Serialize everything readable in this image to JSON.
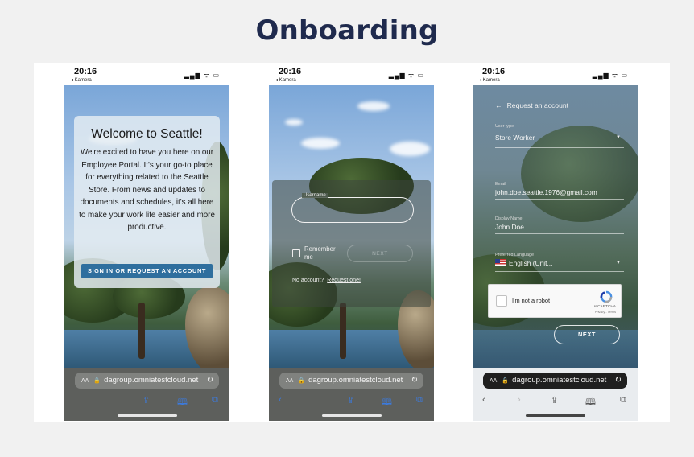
{
  "slide": {
    "title": "Onboarding"
  },
  "phones": [
    {
      "status": {
        "time": "20:16",
        "back_label": "◂ Kamera",
        "icons": "▂▄▆ ᯤ ▭"
      },
      "url": {
        "aa": "AA",
        "text": "dagroup.omniatestcloud.net"
      },
      "welcome": {
        "title": "Welcome to Seattle!",
        "body": "We're excited to have you here on our Employee Portal. It's your go-to place for everything related to the Seattle Store. From news and updates to documents and schedules, it's all here to make your work life easier and more productive.",
        "button": "SIGN IN OR REQUEST AN ACCOUNT"
      }
    },
    {
      "status": {
        "time": "20:16",
        "back_label": "◂ Kamera",
        "icons": "▂▄▆ ᯤ ▭"
      },
      "url": {
        "aa": "AA",
        "text": "dagroup.omniatestcloud.net"
      },
      "login": {
        "username_label": "Username",
        "remember_label": "Remember me",
        "next_label": "NEXT",
        "no_account": "No account?",
        "request_link": "Request one!"
      }
    },
    {
      "status": {
        "time": "20:16",
        "back_label": "◂ Kamera",
        "icons": "▂▄▆ ᯤ ▭"
      },
      "url": {
        "aa": "AA",
        "text": "dagroup.omniatestcloud.net"
      },
      "request": {
        "header": "Request an account",
        "user_type_label": "User type",
        "user_type_value": "Store Worker",
        "email_label": "Email",
        "email_value": "john.doe.seattle.1976@gmail.com",
        "display_name_label": "Display Name",
        "display_name_value": "John Doe",
        "language_label": "Preferred Language",
        "language_value": "English (Unit...",
        "captcha_text": "I'm not a robot",
        "captcha_brand": "reCAPTCHA",
        "captcha_terms": "Privacy - Terms",
        "next_label": "NEXT"
      }
    }
  ]
}
